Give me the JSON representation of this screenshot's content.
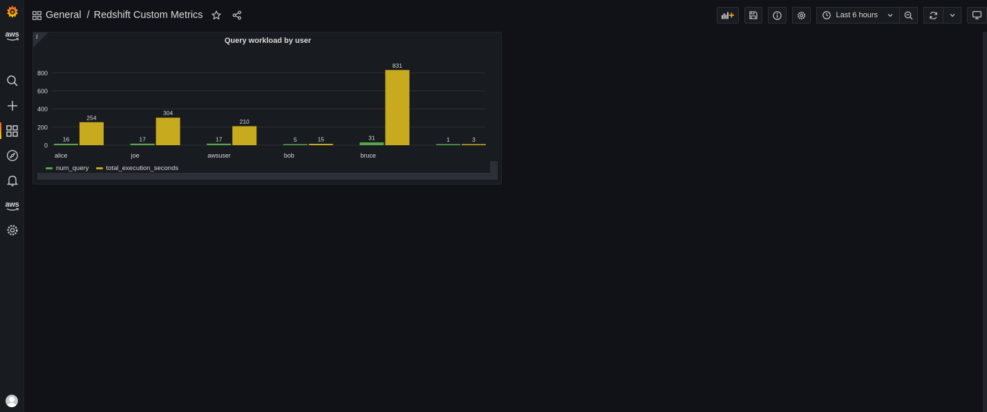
{
  "header": {
    "folder": "General",
    "separator": "/",
    "dashboard_title": "Redshift Custom Metrics",
    "time_range_label": "Last 6 hours"
  },
  "sidebar": {
    "aws_label_top": "aws",
    "aws_label_mid": "aws",
    "icons": [
      "grafana-logo-icon",
      "search-icon",
      "plus-icon",
      "dashboards-icon",
      "explore-compass-icon",
      "alerting-bell-icon",
      "aws-icon",
      "gear-icon",
      "user-avatar"
    ]
  },
  "colors": {
    "accent": "#f05a28",
    "series_num_query": "#56a64b",
    "series_total_exec": "#c8aa1e"
  },
  "panel": {
    "info_glyph": "i",
    "title": "Query workload by user"
  },
  "chart_data": {
    "type": "bar",
    "title": "Query workload by user",
    "categories": [
      "alice",
      "joe",
      "awsuser",
      "bob",
      "bruce",
      ""
    ],
    "series": [
      {
        "name": "num_query",
        "color": "#56a64b",
        "values": [
          16,
          17,
          17,
          5,
          31,
          1
        ]
      },
      {
        "name": "total_execution_seconds",
        "color": "#c8aa1e",
        "values": [
          254,
          304,
          210,
          15,
          831,
          3
        ]
      }
    ],
    "yticks": [
      0,
      200,
      400,
      600,
      800
    ],
    "ylim": [
      0,
      831
    ],
    "grid": true,
    "legend_placement": "bottom-left",
    "data_labels": true
  }
}
